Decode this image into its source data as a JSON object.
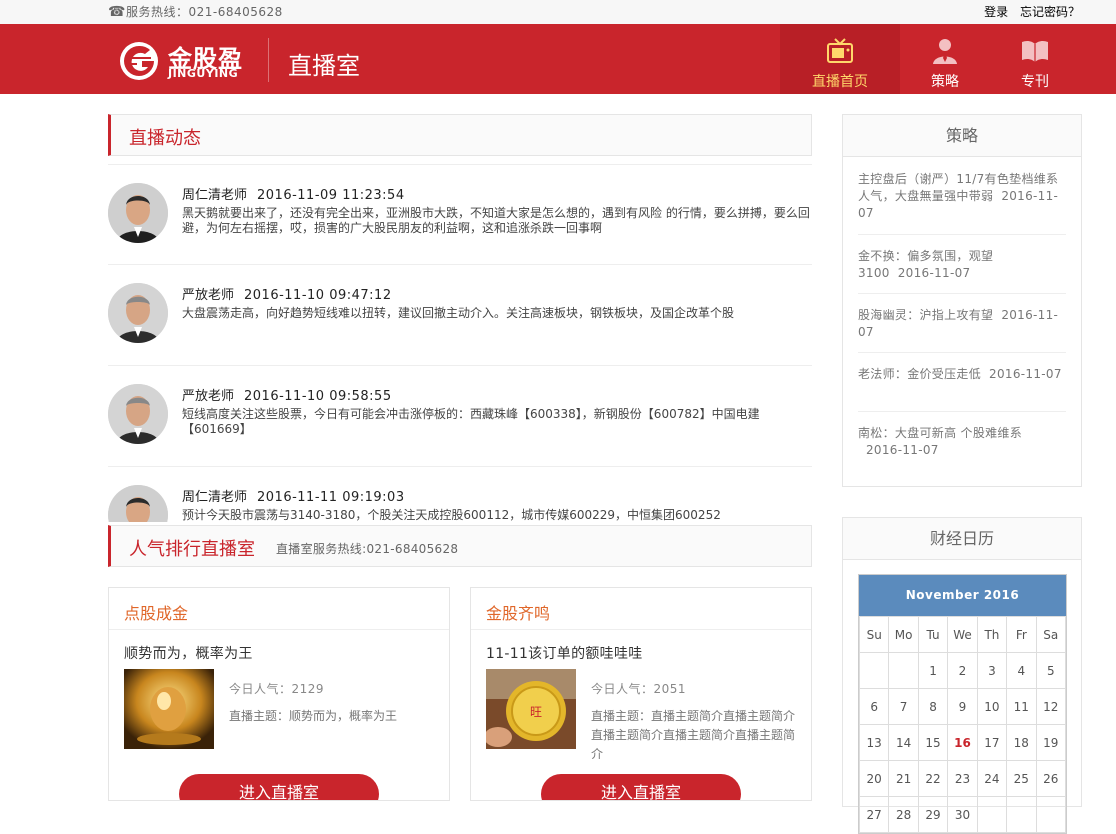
{
  "topbar": {
    "hotline": "服务热线：021-68405628",
    "login": "登录",
    "forgot": "忘记密码？"
  },
  "header": {
    "logo_cn": "金股盈",
    "logo_en": "JINGUYING",
    "page_title": "直播室",
    "nav": [
      {
        "label": "直播首页",
        "icon": "tv-icon"
      },
      {
        "label": "策略",
        "icon": "person-icon"
      },
      {
        "label": "专刊",
        "icon": "book-icon"
      }
    ]
  },
  "live": {
    "title": "直播动态",
    "posts": [
      {
        "author": "周仁清老师",
        "time": "2016-11-09 11:23:54",
        "text": "黑天鹅就要出来了，还没有完全出来，亚洲股市大跌，不知道大家是怎么想的，遇到有风险 的行情，要么拼搏，要么回避，为何左右摇摆，哎，损害的广大股民朋友的利益啊，这和追涨杀跌一回事啊"
      },
      {
        "author": "严放老师",
        "time": "2016-11-10 09:47:12",
        "text": "大盘震荡走高，向好趋势短线难以扭转，建议回撤主动介入。关注高速板块，钢铁板块，及国企改革个股"
      },
      {
        "author": "严放老师",
        "time": "2016-11-10 09:58:55",
        "text": "短线高度关注这些股票，今日有可能会冲击涨停板的：西藏珠峰【600338】，新钢股份【600782】中国电建【601669】"
      },
      {
        "author": "周仁清老师",
        "time": "2016-11-11 09:19:03",
        "text": "预计今天股市震荡与3140-3180，个股关注天成控股600112，城市传媒600229，中恒集团600252"
      }
    ]
  },
  "rank": {
    "title": "人气排行直播室",
    "hotline": "直播室服务热线:021-68405628"
  },
  "rooms": [
    {
      "name": "点股成金",
      "slogan": "顺势而为，概率为王",
      "popularity": "今日人气：2129",
      "topic": "直播主题：顺势而为，概率为王",
      "enter": "进入直播室"
    },
    {
      "name": "金股齐鸣",
      "slogan": "11-11该订单的额哇哇哇",
      "popularity": "今日人气：2051",
      "topic": "直播主题：直播主题简介直播主题简介直播主题简介直播主题简介直播主题简介",
      "enter": "进入直播室"
    }
  ],
  "strategy": {
    "title": "策略",
    "items": [
      {
        "text": "主控盘后（谢严）11/7有色垫档维系人气，大盘無量强中带弱",
        "date": "2016-11-07"
      },
      {
        "text": "金不换：偏多氛围，观望3100",
        "date": "2016-11-07"
      },
      {
        "text": "股海幽灵：沪指上攻有望",
        "date": "2016-11-07"
      },
      {
        "text": "老法师：金价受压走低",
        "date": "2016-11-07"
      },
      {
        "text": "南松：大盘可新高 个股难维系",
        "date": "2016-11-07"
      }
    ]
  },
  "calendar": {
    "title": "财经日历",
    "month": "November 2016",
    "weekdays": [
      "Su",
      "Mo",
      "Tu",
      "We",
      "Th",
      "Fr",
      "Sa"
    ],
    "weeks": [
      [
        "",
        "",
        "1",
        "2",
        "3",
        "4",
        "5"
      ],
      [
        "6",
        "7",
        "8",
        "9",
        "10",
        "11",
        "12"
      ],
      [
        "13",
        "14",
        "15",
        "16",
        "17",
        "18",
        "19"
      ],
      [
        "20",
        "21",
        "22",
        "23",
        "24",
        "25",
        "26"
      ],
      [
        "27",
        "28",
        "29",
        "30",
        "",
        "",
        ""
      ]
    ],
    "today": "16"
  },
  "colors": {
    "brand_red": "#c9252c",
    "nav_active_text": "#ffd86b",
    "calendar_header": "#5b8bbd",
    "room_title": "#e0672a"
  }
}
